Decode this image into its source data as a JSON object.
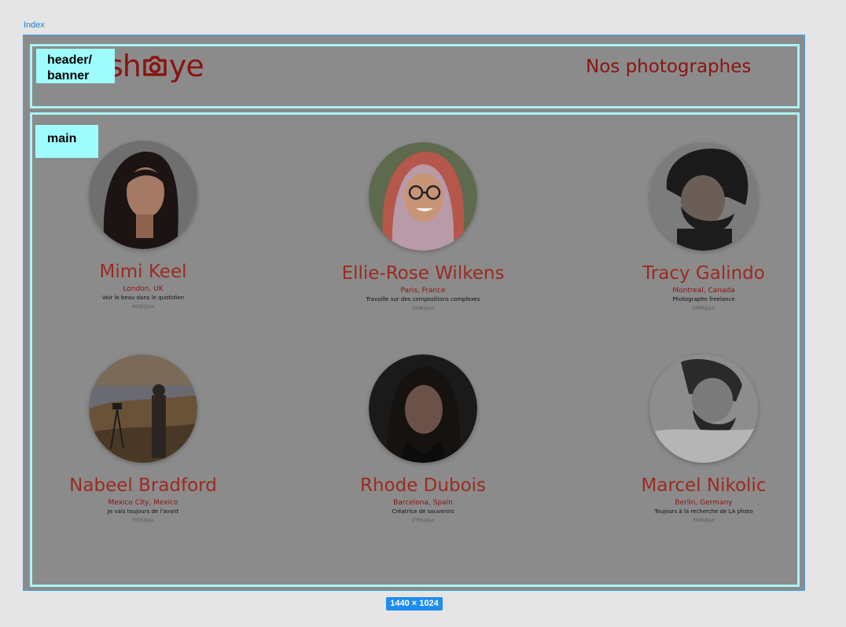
{
  "frame": {
    "label": "Index",
    "size_badge": "1440 × 1024"
  },
  "tags": {
    "header": "header/\nbanner",
    "main": "main"
  },
  "header": {
    "logo_text_left": "sh",
    "logo_text_right": "ye",
    "title": "Nos photographes"
  },
  "photographers": [
    {
      "name": "Mimi Keel",
      "city": "London, UK",
      "tagline": "Voir le beau dans le quotidien",
      "price": "400€/jour"
    },
    {
      "name": "Ellie-Rose Wilkens",
      "city": "Paris, France",
      "tagline": "Travaille sur des compositions complexes",
      "price": "250€/jour"
    },
    {
      "name": "Tracy Galindo",
      "city": "Montreal, Canada",
      "tagline": "Photographe freelance",
      "price": "500€/jour"
    },
    {
      "name": "Nabeel Bradford",
      "city": "Mexico City, Mexico",
      "tagline": "Je vais toujours de l'avant",
      "price": "350€/jour"
    },
    {
      "name": "Rhode Dubois",
      "city": "Barcelona, Spain",
      "tagline": "Créatrice de souvenirs",
      "price": "275€/jour"
    },
    {
      "name": "Marcel Nikolic",
      "city": "Berlin, Germany",
      "tagline": "Toujours à la recherche de LA photo",
      "price": "300€/jour"
    }
  ],
  "colors": {
    "accent": "#8a1410",
    "name": "#9c2a20",
    "overlay": "#8b8b8b",
    "annotation": "#a9f4f4",
    "selection": "#3aa0ff"
  }
}
